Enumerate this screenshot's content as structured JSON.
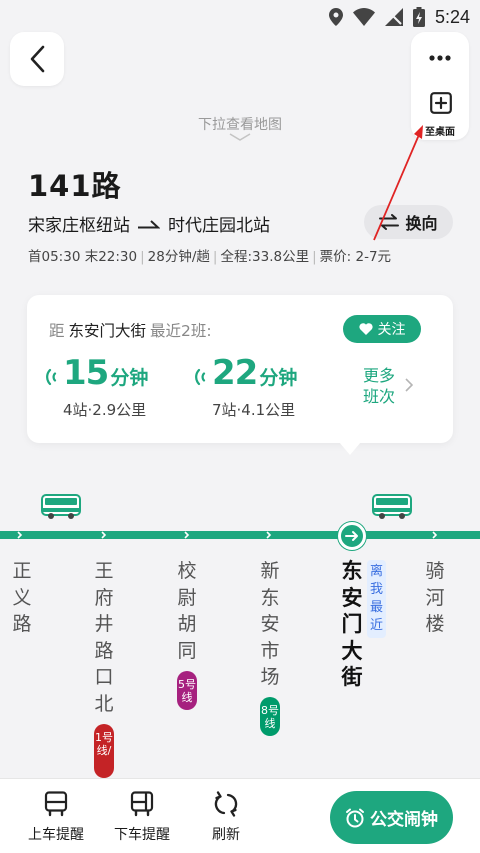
{
  "status": {
    "time": "5:24"
  },
  "header": {
    "pull_hint": "下拉查看地图",
    "desk_label": "至桌面"
  },
  "route": {
    "name": "141路",
    "from": "宋家庄枢纽站",
    "to": "时代庄园北站",
    "swap_label": "换向",
    "first_last": "首05:30 末22:30",
    "interval": "28分钟/趟",
    "distance": "全程:33.8公里",
    "fare": "票价: 2-7元"
  },
  "card": {
    "prefix": "距",
    "station": "东安门大街",
    "suffix": "最近2班:",
    "follow_label": "关注",
    "arrivals": [
      {
        "minutes": "15",
        "unit": "分钟",
        "detail": "4站·2.9公里"
      },
      {
        "minutes": "22",
        "unit": "分钟",
        "detail": "7站·4.1公里"
      }
    ],
    "more_label": "更多班次"
  },
  "stops": [
    {
      "name": "正义路"
    },
    {
      "name": "王府井路口北",
      "metro": "1号线/"
    },
    {
      "name": "校尉胡同",
      "metro": "5号线"
    },
    {
      "name": "新东安市场",
      "metro": "8号线"
    },
    {
      "name": "东安门大街",
      "tag": "离我最近"
    },
    {
      "name": "骑河楼"
    }
  ],
  "colors": {
    "accent": "#1ea77f",
    "metro1": "#c42326",
    "metro5": "#a6217f",
    "metro8": "#009b6b",
    "tag": "#3a6fe0",
    "annotation": "#e02424"
  },
  "bottom": {
    "board_label": "上车提醒",
    "alight_label": "下车提醒",
    "refresh_label": "刷新",
    "alarm_label": "公交闹钟"
  }
}
